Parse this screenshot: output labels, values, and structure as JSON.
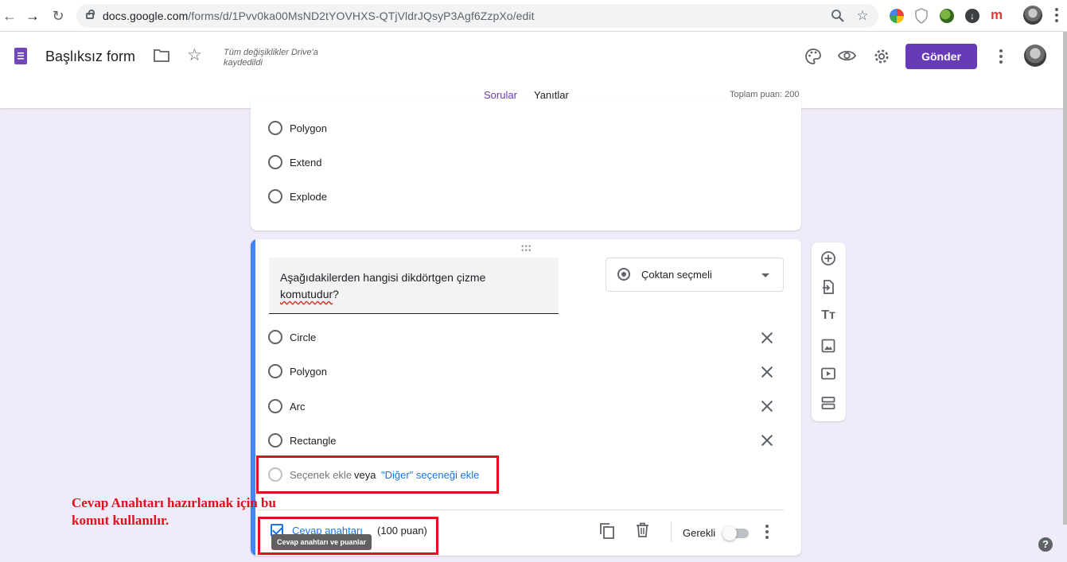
{
  "browser": {
    "url_host": "docs.google.com",
    "url_path": "/forms/d/1Pvv0ka00MsND2tYOVHXS-QTjVldrJQsyP3Agf6ZzpXo/edit",
    "extension_icons": [
      "colorful-extension-icon",
      "shield-extension-icon",
      "globe-extension-icon",
      "download-extension-icon",
      "m-extension-icon"
    ],
    "m_ext_label": "m"
  },
  "header": {
    "title": "Başlıksız form",
    "save_status_line1": "Tüm değişiklikler Drive'a",
    "save_status_line2": "kaydedildi",
    "send_label": "Gönder",
    "accent_color": "#673ab7"
  },
  "tabs": {
    "questions": "Sorular",
    "responses": "Yanıtlar",
    "total_points": "Toplam puan: 200"
  },
  "previous_question": {
    "options": [
      "Polygon",
      "Extend",
      "Explode"
    ]
  },
  "question": {
    "text_part1": "Aşağıdakilerden hangisi dikdörtgen çizme",
    "text_part2": "komutudur",
    "text_part3": "?",
    "type_label": "Çoktan seçmeli",
    "options": [
      "Circle",
      "Polygon",
      "Arc",
      "Rectangle"
    ],
    "add_option": "Seçenek ekle",
    "or_label": "veya",
    "add_other": "\"Diğer\" seçeneği ekle",
    "answer_key_label": "Cevap anahtarı",
    "answer_key_points": "(100 puan)",
    "tooltip": "Cevap anahtarı ve puanlar",
    "required_label": "Gerekli",
    "required": false
  },
  "annotation": {
    "line1": "Cevap Anahtarı hazırlamak için bu",
    "line2": "komut kullanılır.",
    "color": "#e0101e"
  }
}
